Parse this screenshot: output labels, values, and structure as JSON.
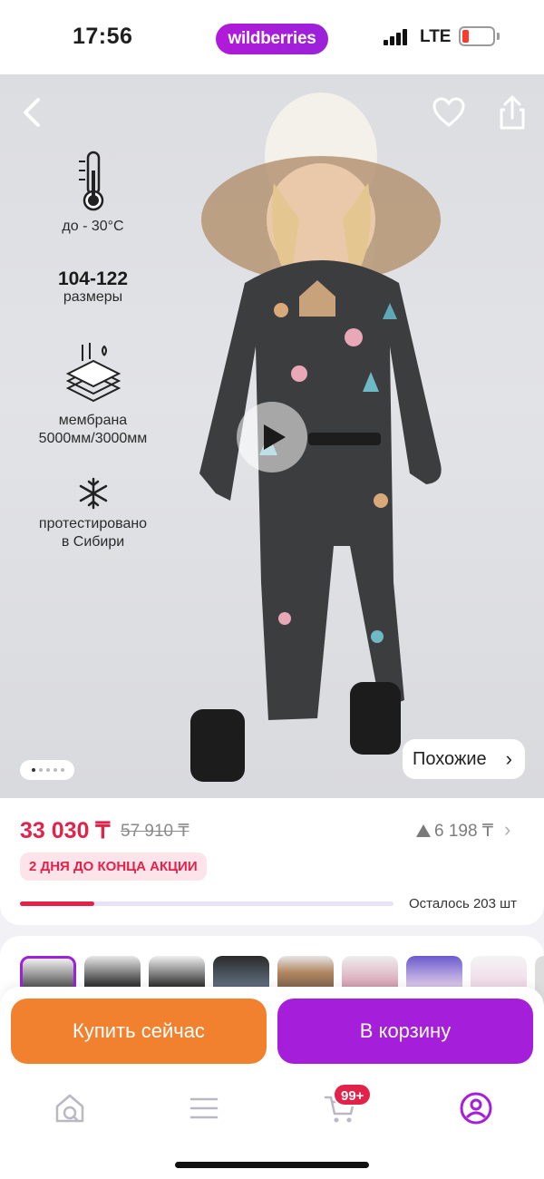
{
  "status_bar": {
    "time": "17:56",
    "network": "LTE",
    "brand": "wildberries"
  },
  "hero": {
    "features": [
      {
        "icon": "thermometer-icon",
        "line1": "до - 30°C",
        "line2": ""
      },
      {
        "icon": "",
        "line1": "104-122",
        "line2": "размеры"
      },
      {
        "icon": "membrane-icon",
        "line1": "мембрана",
        "line2": "5000мм/3000мм"
      },
      {
        "icon": "snowflake-icon",
        "line1": "протестировано",
        "line2": "в Сибири"
      }
    ],
    "similar_label": "Похожие",
    "slide_count": 5,
    "active_slide": 0
  },
  "price": {
    "current": "33 030 ₸",
    "old": "57 910 ₸",
    "bonus": "6 198 ₸",
    "promo": "2 ДНЯ ДО КОНЦА АКЦИИ",
    "stock_text": "Осталось 203 шт",
    "stock_fraction": 0.2
  },
  "thumbnails": {
    "count": 9,
    "selected": 0
  },
  "actions": {
    "buy_now": "Купить сейчас",
    "add_to_cart": "В корзину"
  },
  "tabbar": {
    "cart_badge": "99+"
  },
  "colors": {
    "brand": "#a51ed9",
    "buy_now": "#f1812f",
    "price": "#e3224a"
  }
}
